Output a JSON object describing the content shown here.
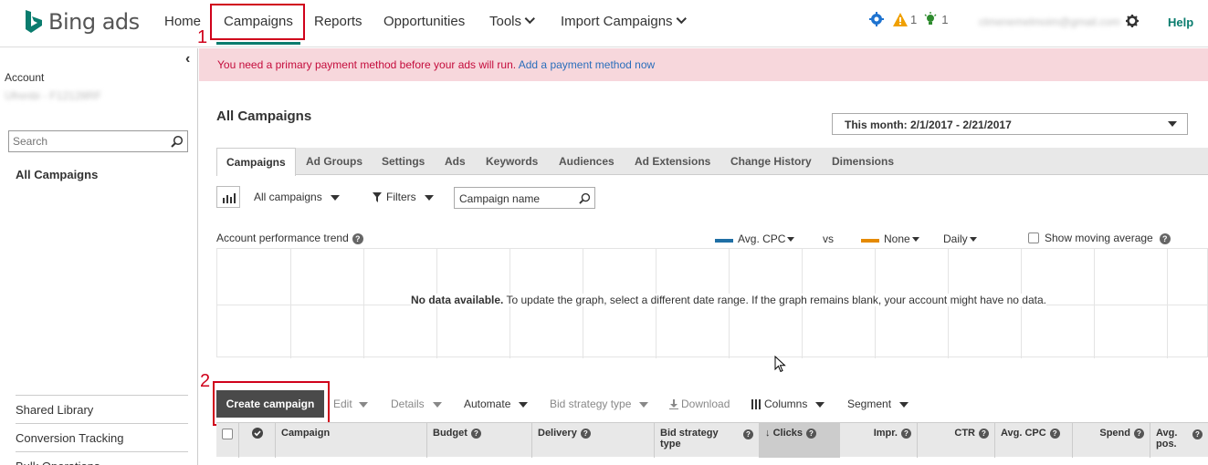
{
  "brand": {
    "name": "Bing ads",
    "accent_color": "#0a7c6e"
  },
  "nav": {
    "items": [
      "Home",
      "Campaigns",
      "Reports",
      "Opportunities",
      "Tools",
      "Import Campaigns"
    ],
    "active": "Campaigns",
    "alerts_count": "1",
    "ideas_count": "1",
    "user_email": "ctmenemelmoim@gmail.com",
    "help": "Help"
  },
  "annotations": {
    "step1": "1",
    "step2": "2"
  },
  "sidebar": {
    "account_label": "Account",
    "account_name": "Ufrenbi - F12128RF",
    "search_placeholder": "Search",
    "all_campaigns": "All Campaigns",
    "links": [
      "Shared Library",
      "Conversion Tracking",
      "Bulk Operations"
    ]
  },
  "banner": {
    "message": "You need a primary payment method before your ads will run.",
    "link": "Add a payment method now"
  },
  "main": {
    "title": "All Campaigns",
    "date_range": "This month: 2/1/2017 - 2/21/2017",
    "tabs": [
      "Campaigns",
      "Ad Groups",
      "Settings",
      "Ads",
      "Keywords",
      "Audiences",
      "Ad Extensions",
      "Change History",
      "Dimensions"
    ],
    "filter": {
      "scope": "All campaigns",
      "filters": "Filters",
      "name_placeholder": "Campaign name"
    },
    "chart": {
      "title": "Account performance trend",
      "metric1": "Avg. CPC",
      "metric1_color": "#1f6fa5",
      "vs": "vs",
      "metric2": "None",
      "metric2_color": "#e58a00",
      "granularity": "Daily",
      "moving_average": "Show moving average",
      "nodata_bold": "No data available.",
      "nodata_text": " To update the graph, select a different date range. If the graph remains blank, your account might have no data."
    },
    "actions": {
      "create": "Create campaign",
      "edit": "Edit",
      "details": "Details",
      "automate": "Automate",
      "bid_strategy": "Bid strategy type",
      "download": "Download",
      "columns": "Columns",
      "segment": "Segment"
    },
    "columns": [
      "Campaign",
      "Budget",
      "Delivery",
      "Bid strategy type",
      "Clicks",
      "Impr.",
      "CTR",
      "Avg. CPC",
      "Spend",
      "Avg. pos."
    ]
  }
}
